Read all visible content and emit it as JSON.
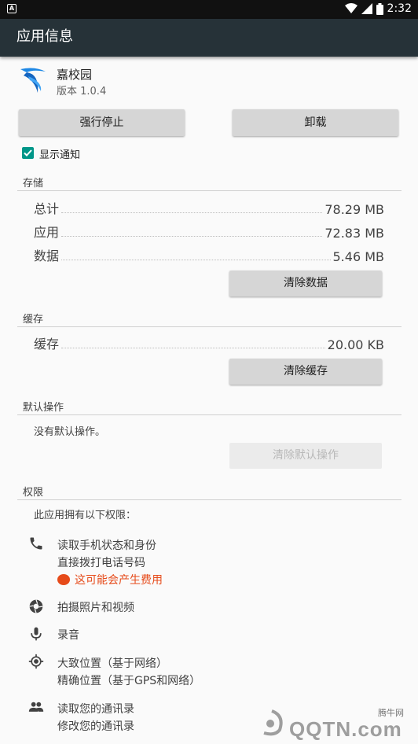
{
  "status_bar": {
    "notification_icon": "A",
    "time": "2:32",
    "icons": [
      "wifi-icon",
      "signal-icon",
      "battery-icon"
    ]
  },
  "app_bar": {
    "title": "应用信息"
  },
  "app": {
    "name": "嘉校园",
    "version": "版本 1.0.4"
  },
  "buttons": {
    "force_stop": "强行停止",
    "uninstall": "卸载",
    "clear_data": "清除数据",
    "clear_cache": "清除缓存",
    "clear_defaults": "清除默认操作"
  },
  "notifications": {
    "label": "显示通知",
    "checked": true
  },
  "storage": {
    "title": "存储",
    "rows": [
      {
        "label": "总计",
        "value": "78.29 MB"
      },
      {
        "label": "应用",
        "value": "72.83 MB"
      },
      {
        "label": "数据",
        "value": "5.46 MB"
      }
    ]
  },
  "cache": {
    "title": "缓存",
    "label": "缓存",
    "value": "20.00 KB"
  },
  "defaults": {
    "title": "默认操作",
    "text": "没有默认操作。"
  },
  "permissions": {
    "title": "权限",
    "intro": "此应用拥有以下权限：",
    "phone": {
      "line1": "读取手机状态和身份",
      "line2": "直接拨打电话号码",
      "warning": "这可能会产生费用"
    },
    "camera": "拍摄照片和视频",
    "microphone": "录音",
    "location": {
      "line1": "大致位置（基于网络）",
      "line2": "精确位置（基于GPS和网络）"
    },
    "contacts": {
      "line1": "读取您的通讯录",
      "line2": "修改您的通讯录"
    }
  },
  "watermark": {
    "text": "腾牛网",
    "logo": "QQTN.com"
  },
  "colors": {
    "app_bar": "#263238",
    "accent": "#009688",
    "warning": "#e64a19"
  }
}
